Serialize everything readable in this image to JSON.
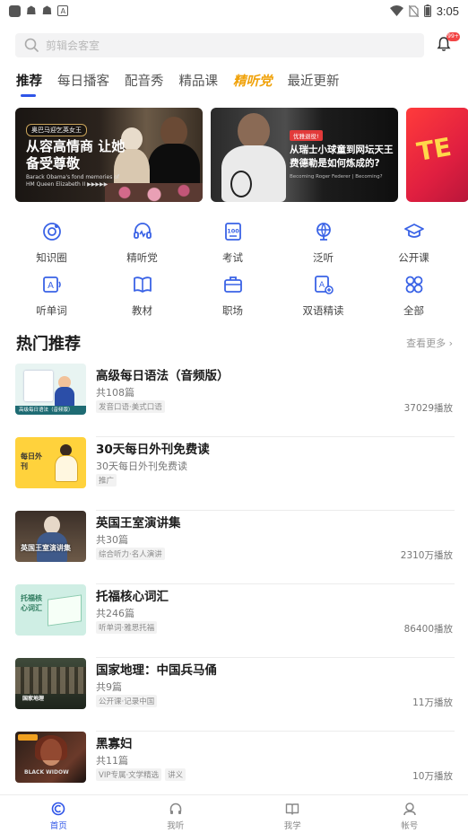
{
  "status_bar": {
    "time": "3:05"
  },
  "search": {
    "placeholder": "剪辑会客室",
    "badge": "99+"
  },
  "tabs": [
    {
      "label": "推荐"
    },
    {
      "label": "每日播客"
    },
    {
      "label": "配音秀"
    },
    {
      "label": "精品课"
    },
    {
      "label": "精听党"
    },
    {
      "label": "最近更新"
    }
  ],
  "banners": [
    {
      "tag": "奥巴马迎乞英女王",
      "title": "从容高情商 让她备受尊敬",
      "subtitle": "Barack Obama's fond memories of HM Queen Elizabeth II ▶▶▶▶▶"
    },
    {
      "tag": "优雅退役!",
      "title": "从瑞士小球童到网坛天王 费德勒是如何炼成的?",
      "subtitle": "Becoming Roger Federer | Becoming?"
    },
    {
      "text": "TE"
    }
  ],
  "grid": [
    {
      "label": "知识圈",
      "icon": "knowledge-circle-icon"
    },
    {
      "label": "精听党",
      "icon": "headset-icon"
    },
    {
      "label": "考试",
      "icon": "exam-icon"
    },
    {
      "label": "泛听",
      "icon": "globe-icon"
    },
    {
      "label": "公开课",
      "icon": "graduation-cap-icon"
    },
    {
      "label": "听单词",
      "icon": "word-card-icon"
    },
    {
      "label": "教材",
      "icon": "book-icon"
    },
    {
      "label": "职场",
      "icon": "briefcase-icon"
    },
    {
      "label": "双语精读",
      "icon": "bilingual-icon"
    },
    {
      "label": "全部",
      "icon": "all-icon"
    }
  ],
  "hot": {
    "title": "热门推荐",
    "more": "查看更多"
  },
  "items": [
    {
      "title": "高级每日语法（音频版）",
      "count": "共108篇",
      "tags": [
        "发音口语·美式口语"
      ],
      "plays": "37029播放",
      "thumb_text": "高级每日语法（音频版）"
    },
    {
      "title": "30天每日外刊免费读",
      "count": "30天每日外刊免费读",
      "tags": [
        "推广"
      ],
      "plays": "",
      "thumb_text": "每日外刊"
    },
    {
      "title": "英国王室演讲集",
      "count": "共30篇",
      "tags": [
        "综合听力·名人演讲"
      ],
      "plays": "2310万播放",
      "thumb_text": "英国王室演讲集"
    },
    {
      "title": "托福核心词汇",
      "count": "共246篇",
      "tags": [
        "听单词·雅思托福"
      ],
      "plays": "86400播放",
      "thumb_text": "托福核心词汇"
    },
    {
      "title": "国家地理：中国兵马俑",
      "count": "共9篇",
      "tags": [
        "公开课·记录中国"
      ],
      "plays": "11万播放",
      "thumb_text": "国家地理"
    },
    {
      "title": "黑寡妇",
      "count": "共11篇",
      "tags": [
        "VIP专属·文学精选",
        "讲义"
      ],
      "plays": "10万播放",
      "thumb_text": "BLACK WIDOW"
    }
  ],
  "bottom_nav": [
    {
      "label": "首页",
      "icon": "home-icon",
      "active": true
    },
    {
      "label": "我听",
      "icon": "headphones-icon",
      "active": false
    },
    {
      "label": "我学",
      "icon": "open-book-icon",
      "active": false
    },
    {
      "label": "帐号",
      "icon": "account-icon",
      "active": false
    }
  ],
  "colors": {
    "accent": "#2f55e8",
    "highlight_tab": "#f0a20a",
    "badge": "#f24646"
  }
}
